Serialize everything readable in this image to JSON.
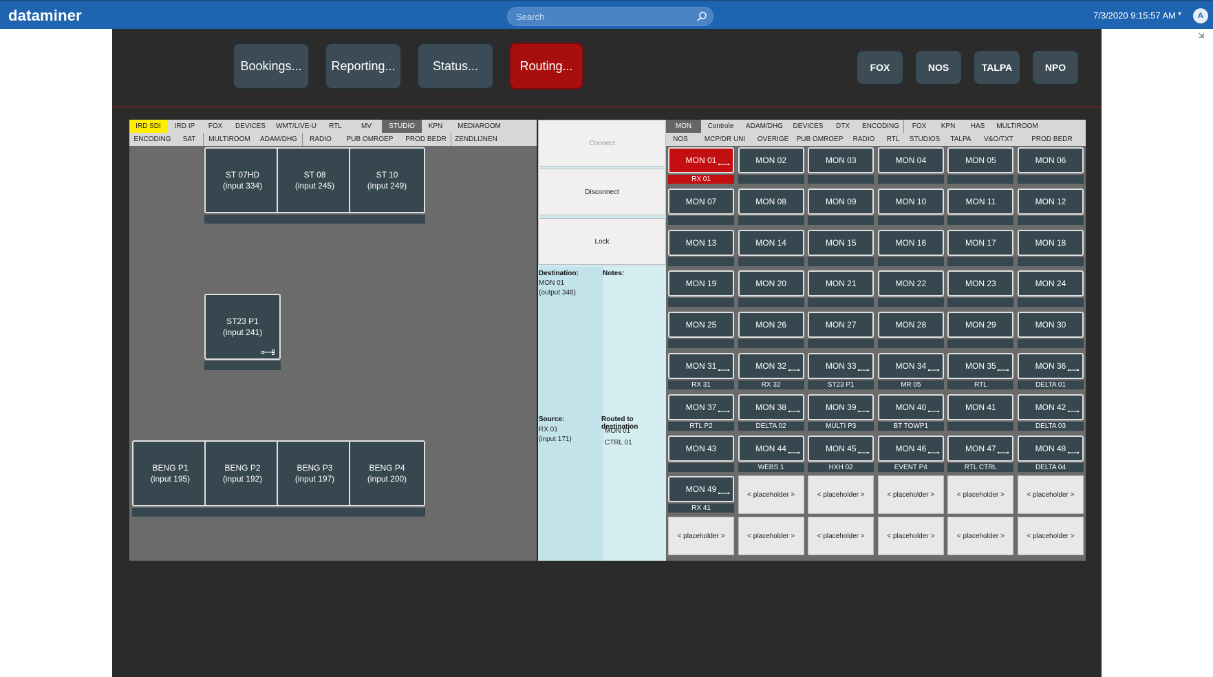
{
  "header": {
    "brand": "dataminer",
    "search_placeholder": "Search",
    "datetime": "7/3/2020 9:15:57 AM",
    "avatar_letter": "A"
  },
  "nav": {
    "bookings": "Bookings...",
    "reporting": "Reporting...",
    "status": "Status...",
    "routing": "Routing...",
    "active": "Routing...",
    "broadcasters": [
      "FOX",
      "NOS",
      "TALPA",
      "NPO"
    ]
  },
  "source_tabs": {
    "row1": [
      "IRD SDI",
      "IRD IP",
      "FOX",
      "DEVICES",
      "WMT/LIVE-U",
      "RTL",
      "MV",
      "STUDIO",
      "KPN",
      "MEDIAROOM"
    ],
    "row2": [
      "ENCODING",
      "SAT",
      "MULTIROOM",
      "ADAM/DHG",
      "RADIO",
      "PUB OMROEP",
      "PROD BEDR",
      "ZENDLIJNEN"
    ],
    "selected_highlight": "IRD SDI",
    "selected_active": "STUDIO"
  },
  "sources": [
    {
      "name": "ST 07HD",
      "input": "(input 334)"
    },
    {
      "name": "ST 08",
      "input": "(input 245)"
    },
    {
      "name": "ST 10",
      "input": "(input 249)"
    },
    {
      "name": "ST23 P1",
      "input": "(input 241)"
    },
    {
      "name": "BENG P1",
      "input": "(input 195)"
    },
    {
      "name": "BENG P2",
      "input": "(input 192)"
    },
    {
      "name": "BENG P3",
      "input": "(input 197)"
    },
    {
      "name": "BENG P4",
      "input": "(input 200)"
    }
  ],
  "actions": {
    "connect": "Connect",
    "disconnect": "Disconnect",
    "lock": "Lock"
  },
  "info": {
    "destination_label": "Destination:",
    "notes_label": "Notes:",
    "destination_name": "MON 01",
    "destination_output": "(output 348)",
    "source_label": "Source:",
    "routed_label": "Routed to destination",
    "source_name": "RX 01",
    "source_input": "(input 171)",
    "routed": [
      "MON 01",
      "CTRL 01"
    ]
  },
  "dest_tabs": {
    "row1": [
      "MON",
      "Controle",
      "ADAM/DHG",
      "DEVICES",
      "DTX",
      "ENCODING",
      "FOX",
      "KPN",
      "HAS",
      "MULTIROOM"
    ],
    "row2": [
      "NOS",
      "MCP/DR UNI",
      "OVERIGE",
      "PUB OMROEP",
      "RADIO",
      "RTL",
      "STUDIOS",
      "TALPA",
      "V&O/TXT",
      "PROD BEDR"
    ],
    "selected": "MON"
  },
  "destinations": [
    {
      "name": "MON 01",
      "label": "RX 01",
      "linked": true,
      "selected": true
    },
    {
      "name": "MON 02",
      "label": "",
      "linked": false
    },
    {
      "name": "MON 03",
      "label": "",
      "linked": false
    },
    {
      "name": "MON 04",
      "label": "",
      "linked": false
    },
    {
      "name": "MON 05",
      "label": "",
      "linked": false
    },
    {
      "name": "MON 06",
      "label": "",
      "linked": false
    },
    {
      "name": "MON 07",
      "label": "",
      "linked": false
    },
    {
      "name": "MON 08",
      "label": "",
      "linked": false
    },
    {
      "name": "MON 09",
      "label": "",
      "linked": false
    },
    {
      "name": "MON 10",
      "label": "",
      "linked": false
    },
    {
      "name": "MON 11",
      "label": "",
      "linked": false
    },
    {
      "name": "MON 12",
      "label": "",
      "linked": false
    },
    {
      "name": "MON 13",
      "label": "",
      "linked": false
    },
    {
      "name": "MON 14",
      "label": "",
      "linked": false
    },
    {
      "name": "MON 15",
      "label": "",
      "linked": false
    },
    {
      "name": "MON 16",
      "label": "",
      "linked": false
    },
    {
      "name": "MON 17",
      "label": "",
      "linked": false
    },
    {
      "name": "MON 18",
      "label": "",
      "linked": false
    },
    {
      "name": "MON 19",
      "label": "",
      "linked": false
    },
    {
      "name": "MON 20",
      "label": "",
      "linked": false
    },
    {
      "name": "MON 21",
      "label": "",
      "linked": false
    },
    {
      "name": "MON 22",
      "label": "",
      "linked": false
    },
    {
      "name": "MON 23",
      "label": "",
      "linked": false
    },
    {
      "name": "MON 24",
      "label": "",
      "linked": false
    },
    {
      "name": "MON 25",
      "label": "",
      "linked": false
    },
    {
      "name": "MON 26",
      "label": "",
      "linked": false
    },
    {
      "name": "MON 27",
      "label": "",
      "linked": false
    },
    {
      "name": "MON 28",
      "label": "",
      "linked": false
    },
    {
      "name": "MON 29",
      "label": "",
      "linked": false
    },
    {
      "name": "MON 30",
      "label": "",
      "linked": false
    },
    {
      "name": "MON 31",
      "label": "RX 31",
      "linked": true
    },
    {
      "name": "MON 32",
      "label": "RX 32",
      "linked": true
    },
    {
      "name": "MON 33",
      "label": "ST23 P1",
      "linked": true
    },
    {
      "name": "MON 34",
      "label": "MR 05",
      "linked": true
    },
    {
      "name": "MON 35",
      "label": "RTL",
      "linked": true
    },
    {
      "name": "MON 36",
      "label": "DELTA 01",
      "linked": true
    },
    {
      "name": "MON 37",
      "label": "RTL P2",
      "linked": true
    },
    {
      "name": "MON 38",
      "label": "DELTA 02",
      "linked": true
    },
    {
      "name": "MON 39",
      "label": "MULTI P3",
      "linked": true
    },
    {
      "name": "MON 40",
      "label": "BT TOWP1",
      "linked": true
    },
    {
      "name": "MON 41",
      "label": "",
      "linked": false
    },
    {
      "name": "MON 42",
      "label": "DELTA 03",
      "linked": true
    },
    {
      "name": "MON 43",
      "label": "",
      "linked": false
    },
    {
      "name": "MON 44",
      "label": "WEBS 1",
      "linked": true
    },
    {
      "name": "MON 45",
      "label": "HXH 02",
      "linked": true
    },
    {
      "name": "MON 46",
      "label": "EVENT P4",
      "linked": true
    },
    {
      "name": "MON 47",
      "label": "RTL CTRL",
      "linked": true
    },
    {
      "name": "MON 48",
      "label": "DELTA 04",
      "linked": true
    },
    {
      "name": "MON 49",
      "label": "RX 41",
      "linked": true
    }
  ],
  "placeholder_text": "< placeholder >",
  "placeholder_count": 11
}
